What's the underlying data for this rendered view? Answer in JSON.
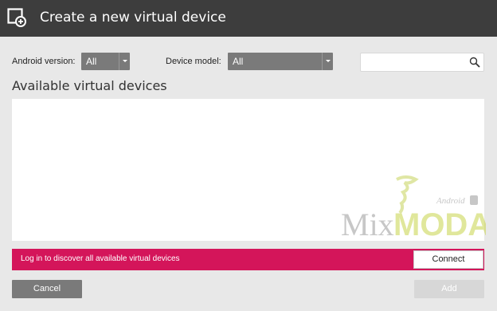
{
  "window": {
    "title": "Create a new virtual device",
    "icon": "new-device-icon"
  },
  "filters": {
    "android_version_label": "Android version:",
    "android_version_value": "All",
    "device_model_label": "Device model:",
    "device_model_value": "All",
    "search_placeholder": "",
    "search_icon": "search-icon"
  },
  "main": {
    "section_title": "Available virtual devices",
    "devices": []
  },
  "login_bar": {
    "message": "Log in to discover all available virtual devices",
    "connect_label": "Connect",
    "color": "#d4155a"
  },
  "footer": {
    "cancel_label": "Cancel",
    "add_label": "Add"
  },
  "watermark": {
    "text": "MixMODA",
    "subtext": "Android"
  }
}
